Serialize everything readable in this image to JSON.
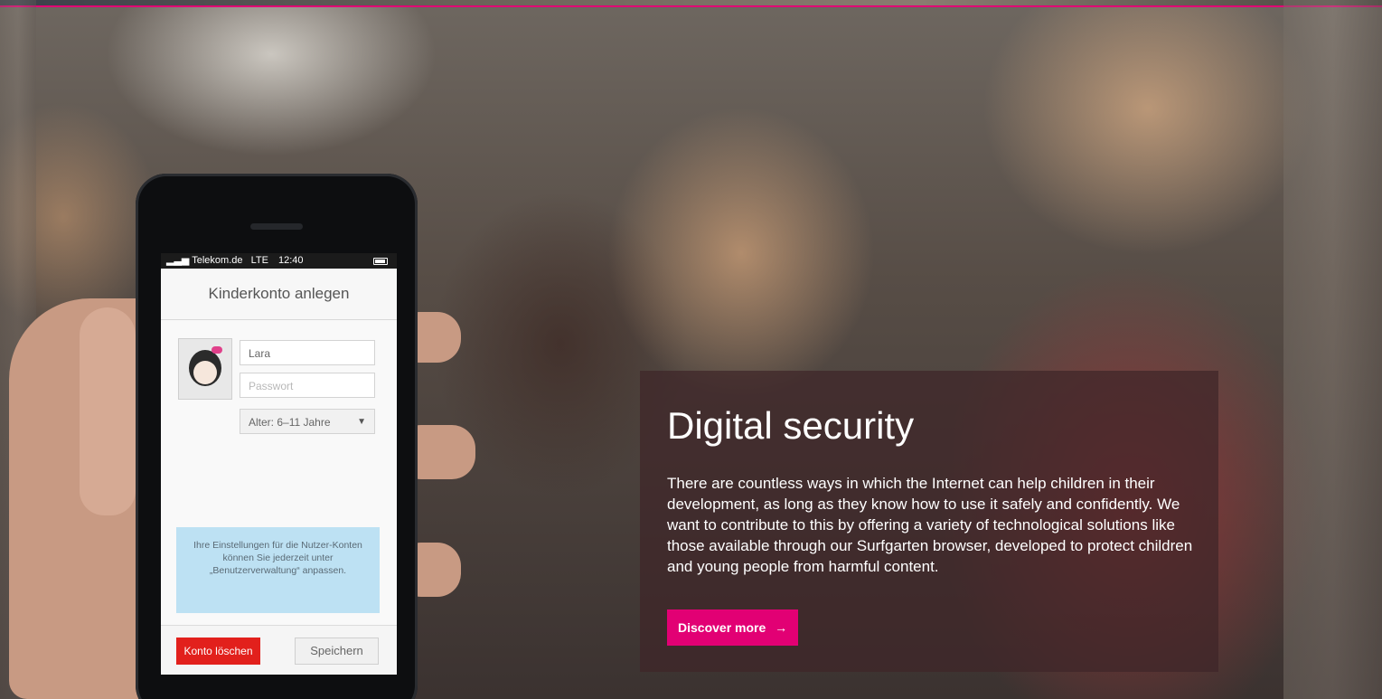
{
  "phone": {
    "status": {
      "carrier": "Telekom.de",
      "network": "LTE",
      "time": "12:40"
    },
    "screen_title": "Kinderkonto anlegen",
    "form": {
      "name_value": "Lara",
      "password_placeholder": "Passwort",
      "age_selected": "Alter: 6–11 Jahre"
    },
    "info_text": "Ihre Einstellungen für die Nutzer-Konten können Sie jederzeit unter „Benutzerverwaltung“ anpassen.",
    "buttons": {
      "delete_label": "Konto löschen",
      "save_label": "Speichern"
    }
  },
  "hero": {
    "title": "Digital security",
    "body": "There are countless ways in which the Internet can help children in their development, as long as they know how to use it safely and confidently. We want to contribute to this by offering a variety of technological solutions like those available through our Surfgarten browser, developed to protect children and young people from harmful content.",
    "cta_label": "Discover more",
    "cta_arrow": "→"
  },
  "colors": {
    "brand_magenta": "#e20074",
    "delete_red": "#e2201c",
    "info_blue": "#bde1f3"
  }
}
